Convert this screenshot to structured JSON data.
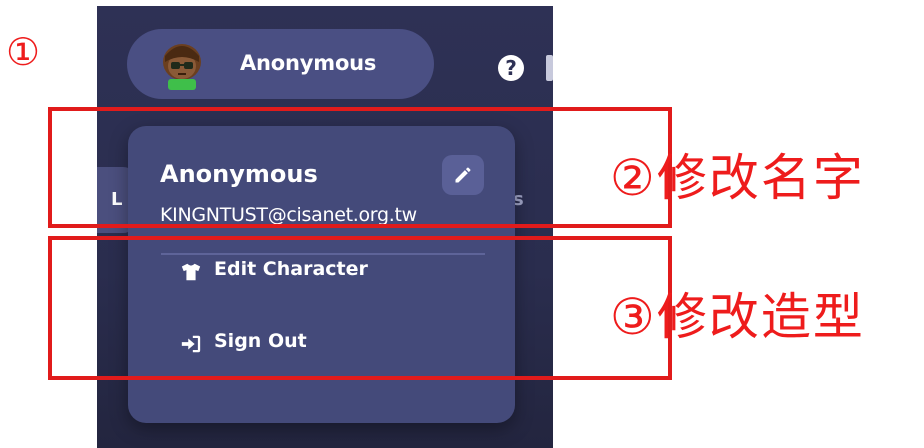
{
  "annotations": {
    "step1": "①",
    "step2": "②修改名字",
    "step3": "③修改造型"
  },
  "header": {
    "profile_name": "Anonymous",
    "help_icon": "question-circle-icon",
    "help_glyph": "?"
  },
  "background_fragments": {
    "left_tab_text": "L",
    "right_text": "s"
  },
  "dropdown": {
    "name": "Anonymous",
    "email": "KINGNTUST@cisanet.org.tw",
    "edit_name_icon": "pencil-icon",
    "items": [
      {
        "label": "Edit Character",
        "icon": "tshirt-icon"
      },
      {
        "label": "Sign Out",
        "icon": "sign-out-icon"
      }
    ]
  },
  "colors": {
    "app_bg": "#2e3155",
    "pill_bg": "#4a4f83",
    "dropdown_bg": "#444a7a",
    "annotation_red": "#e11b1b"
  }
}
